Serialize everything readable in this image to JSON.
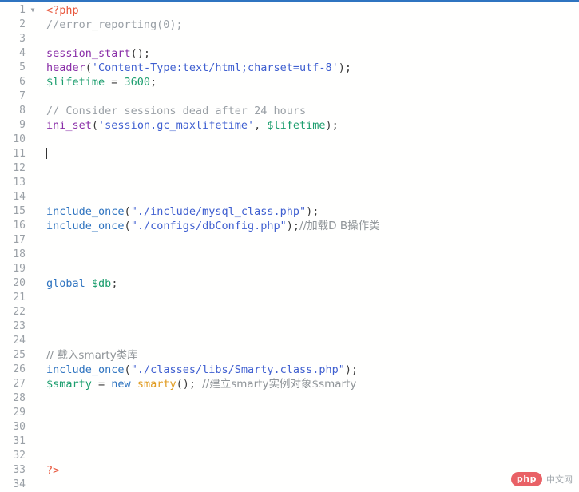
{
  "editor": {
    "name": "php-code-editor",
    "language": "PHP",
    "top_border_color": "#2f74c0",
    "background_color": "#fffffe",
    "gutter_color": "#9aa0a6",
    "first_line": 1,
    "last_line": 34,
    "caret_line": 11,
    "fold_marker": "▼"
  },
  "lines": [
    {
      "num": "1",
      "fold": "▼",
      "tokens": [
        {
          "t": "<?php",
          "c": "tok-tag"
        }
      ]
    },
    {
      "num": "2",
      "fold": "",
      "tokens": [
        {
          "t": "//error_reporting(0);",
          "c": "tok-comment"
        }
      ]
    },
    {
      "num": "3",
      "fold": "",
      "tokens": []
    },
    {
      "num": "4",
      "fold": "",
      "tokens": [
        {
          "t": "session_start",
          "c": "tok-func"
        },
        {
          "t": "();",
          "c": "tok-punc"
        }
      ]
    },
    {
      "num": "5",
      "fold": "",
      "tokens": [
        {
          "t": "header",
          "c": "tok-func"
        },
        {
          "t": "(",
          "c": "tok-punc"
        },
        {
          "t": "'Content-Type:text/html;charset=utf-8'",
          "c": "tok-str"
        },
        {
          "t": ");",
          "c": "tok-punc"
        }
      ]
    },
    {
      "num": "6",
      "fold": "",
      "tokens": [
        {
          "t": "$lifetime",
          "c": "tok-var"
        },
        {
          "t": " = ",
          "c": "tok-punc"
        },
        {
          "t": "3600",
          "c": "tok-num"
        },
        {
          "t": ";",
          "c": "tok-punc"
        }
      ]
    },
    {
      "num": "7",
      "fold": "",
      "tokens": []
    },
    {
      "num": "8",
      "fold": "",
      "tokens": [
        {
          "t": "// Consider sessions dead after 24 hours",
          "c": "tok-comment"
        }
      ]
    },
    {
      "num": "9",
      "fold": "",
      "tokens": [
        {
          "t": "ini_set",
          "c": "tok-func"
        },
        {
          "t": "(",
          "c": "tok-punc"
        },
        {
          "t": "'session.gc_maxlifetime'",
          "c": "tok-str"
        },
        {
          "t": ", ",
          "c": "tok-punc"
        },
        {
          "t": "$lifetime",
          "c": "tok-var"
        },
        {
          "t": ");",
          "c": "tok-punc"
        }
      ]
    },
    {
      "num": "10",
      "fold": "",
      "tokens": []
    },
    {
      "num": "11",
      "fold": "",
      "tokens": [],
      "caret": true
    },
    {
      "num": "12",
      "fold": "",
      "tokens": []
    },
    {
      "num": "13",
      "fold": "",
      "tokens": []
    },
    {
      "num": "14",
      "fold": "",
      "tokens": []
    },
    {
      "num": "15",
      "fold": "",
      "tokens": [
        {
          "t": "include_once",
          "c": "tok-incl"
        },
        {
          "t": "(",
          "c": "tok-punc"
        },
        {
          "t": "\"./include/mysql_class.php\"",
          "c": "tok-str"
        },
        {
          "t": ");",
          "c": "tok-punc"
        }
      ]
    },
    {
      "num": "16",
      "fold": "",
      "tokens": [
        {
          "t": "include_once",
          "c": "tok-incl"
        },
        {
          "t": "(",
          "c": "tok-punc"
        },
        {
          "t": "\"./configs/dbConfig.php\"",
          "c": "tok-str"
        },
        {
          "t": ");",
          "c": "tok-punc"
        },
        {
          "t": "//加载D B操作类",
          "c": "tok-cjk"
        }
      ]
    },
    {
      "num": "17",
      "fold": "",
      "tokens": []
    },
    {
      "num": "18",
      "fold": "",
      "tokens": []
    },
    {
      "num": "19",
      "fold": "",
      "tokens": []
    },
    {
      "num": "20",
      "fold": "",
      "tokens": [
        {
          "t": "global",
          "c": "tok-kw"
        },
        {
          "t": " ",
          "c": "tok-punc"
        },
        {
          "t": "$db",
          "c": "tok-var"
        },
        {
          "t": ";",
          "c": "tok-punc"
        }
      ]
    },
    {
      "num": "21",
      "fold": "",
      "tokens": []
    },
    {
      "num": "22",
      "fold": "",
      "tokens": []
    },
    {
      "num": "23",
      "fold": "",
      "tokens": []
    },
    {
      "num": "24",
      "fold": "",
      "tokens": []
    },
    {
      "num": "25",
      "fold": "",
      "tokens": [
        {
          "t": "// 载入smarty类库",
          "c": "tok-cjk"
        }
      ]
    },
    {
      "num": "26",
      "fold": "",
      "tokens": [
        {
          "t": "include_once",
          "c": "tok-incl"
        },
        {
          "t": "(",
          "c": "tok-punc"
        },
        {
          "t": "\"./classes/libs/Smarty.class.php\"",
          "c": "tok-str"
        },
        {
          "t": ");",
          "c": "tok-punc"
        }
      ]
    },
    {
      "num": "27",
      "fold": "",
      "tokens": [
        {
          "t": "$smarty",
          "c": "tok-var"
        },
        {
          "t": " = ",
          "c": "tok-punc"
        },
        {
          "t": "new",
          "c": "tok-kw"
        },
        {
          "t": " ",
          "c": "tok-punc"
        },
        {
          "t": "smarty",
          "c": "tok-class"
        },
        {
          "t": "(); ",
          "c": "tok-punc"
        },
        {
          "t": "//建立smarty实例对象$smarty",
          "c": "tok-cjk"
        }
      ]
    },
    {
      "num": "28",
      "fold": "",
      "tokens": []
    },
    {
      "num": "29",
      "fold": "",
      "tokens": []
    },
    {
      "num": "30",
      "fold": "",
      "tokens": []
    },
    {
      "num": "31",
      "fold": "",
      "tokens": []
    },
    {
      "num": "32",
      "fold": "",
      "tokens": []
    },
    {
      "num": "33",
      "fold": "",
      "tokens": [
        {
          "t": "?>",
          "c": "tok-tag"
        }
      ]
    },
    {
      "num": "34",
      "fold": "",
      "tokens": []
    }
  ],
  "watermark": {
    "badge_text": "php",
    "site_text": "中文网",
    "badge_color": "#e8545a",
    "text_color": "#9aa0a6"
  }
}
